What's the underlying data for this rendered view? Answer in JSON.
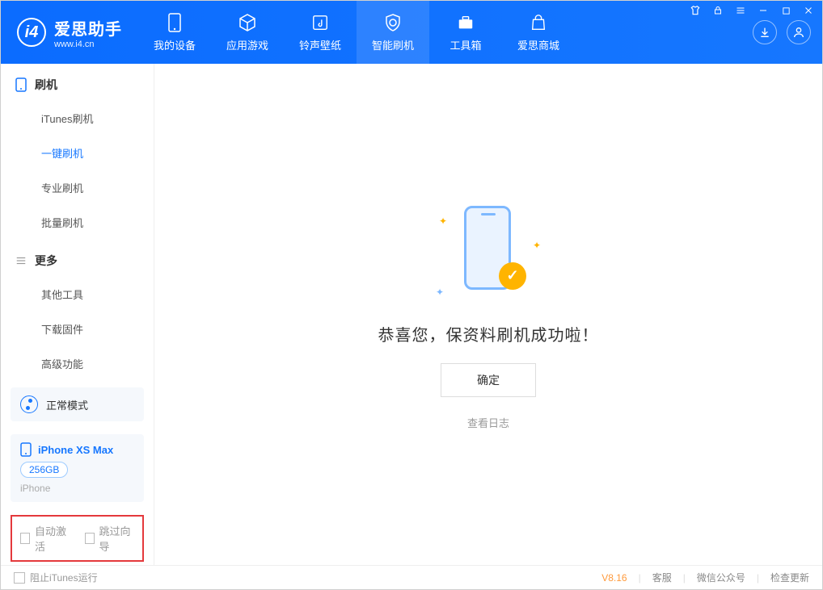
{
  "brand": {
    "title": "爱思助手",
    "subtitle": "www.i4.cn"
  },
  "tabs": [
    {
      "label": "我的设备"
    },
    {
      "label": "应用游戏"
    },
    {
      "label": "铃声壁纸"
    },
    {
      "label": "智能刷机"
    },
    {
      "label": "工具箱"
    },
    {
      "label": "爱思商城"
    }
  ],
  "sidebar": {
    "group1": {
      "title": "刷机",
      "items": [
        "iTunes刷机",
        "一键刷机",
        "专业刷机",
        "批量刷机"
      ]
    },
    "group2": {
      "title": "更多",
      "items": [
        "其他工具",
        "下载固件",
        "高级功能"
      ]
    }
  },
  "mode": {
    "label": "正常模式"
  },
  "device": {
    "name": "iPhone XS Max",
    "storage": "256GB",
    "type": "iPhone"
  },
  "options": {
    "auto_activate": "自动激活",
    "skip_guide": "跳过向导"
  },
  "main": {
    "success_message": "恭喜您，保资料刷机成功啦！",
    "confirm_button": "确定",
    "view_log": "查看日志"
  },
  "footer": {
    "block_itunes": "阻止iTunes运行",
    "version": "V8.16",
    "links": [
      "客服",
      "微信公众号",
      "检查更新"
    ]
  }
}
